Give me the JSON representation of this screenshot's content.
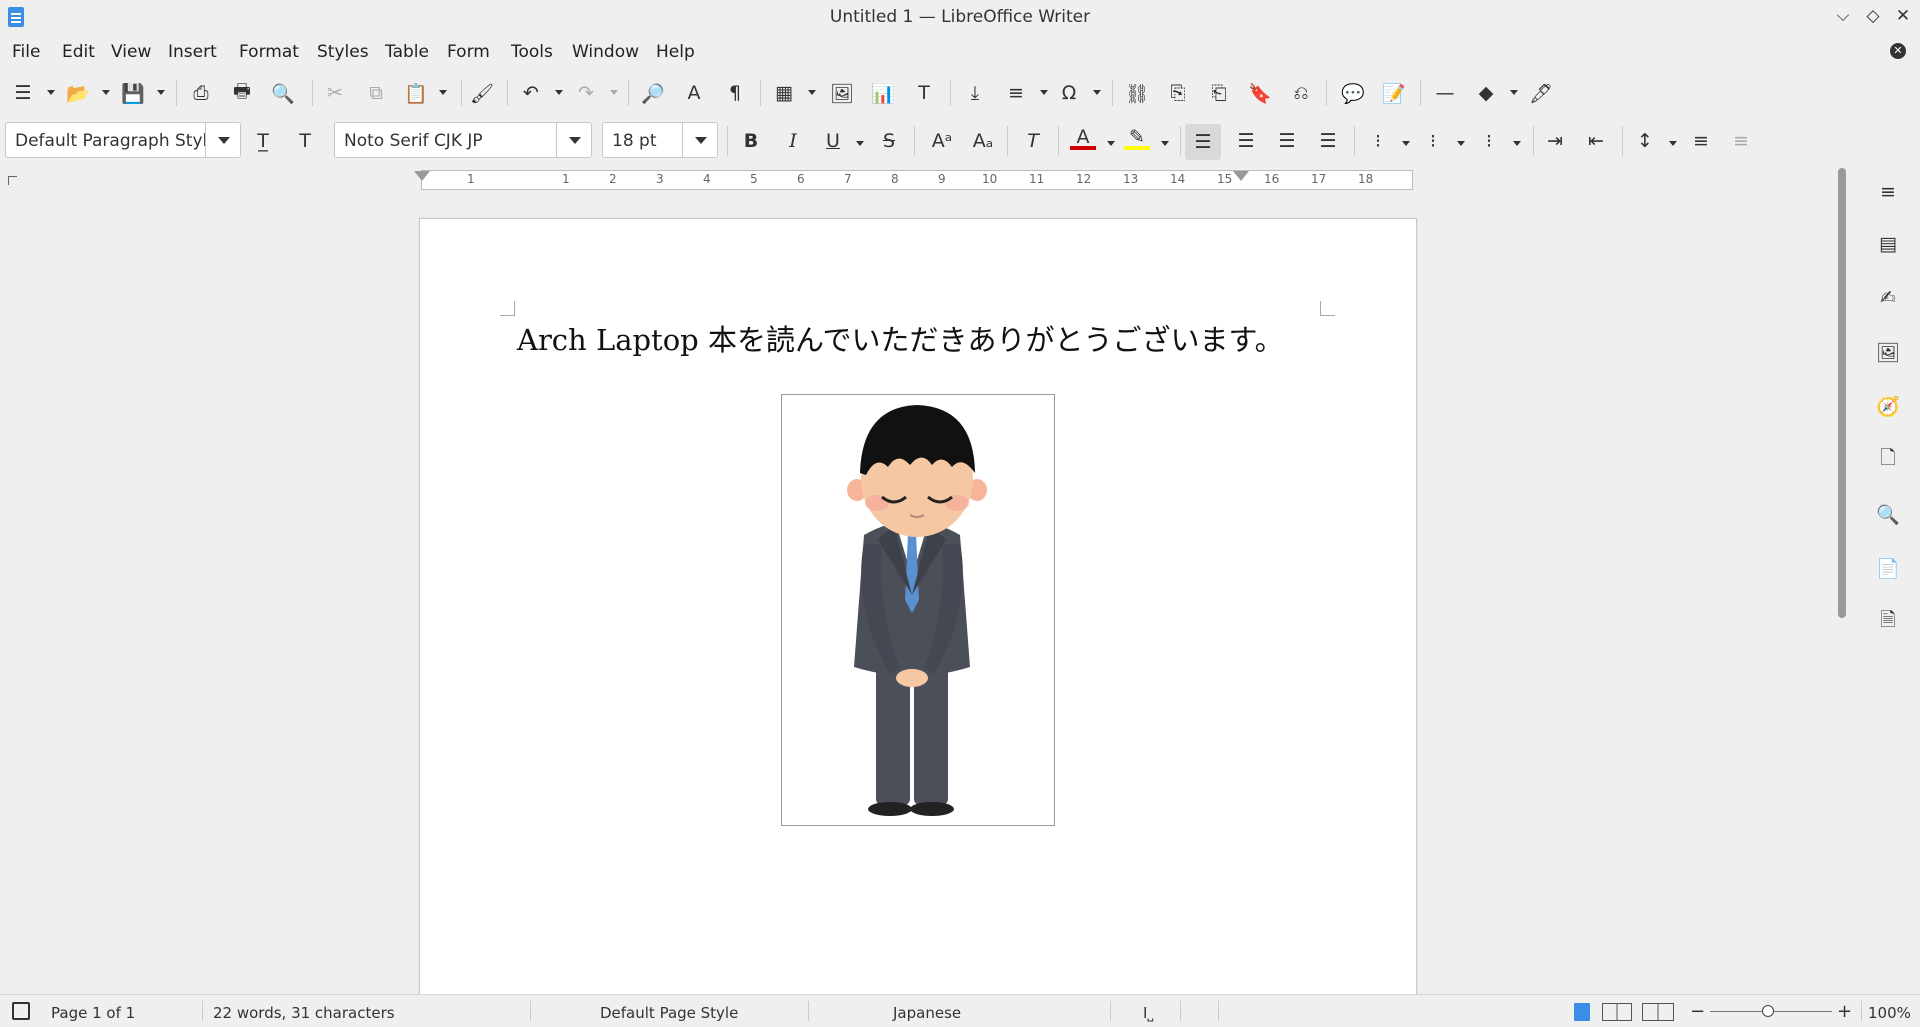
{
  "window": {
    "title": "Untitled 1 — LibreOffice Writer",
    "controls": [
      "⌵",
      "◇",
      "✕"
    ]
  },
  "menu": [
    "File",
    "Edit",
    "View",
    "Insert",
    "Format",
    "Styles",
    "Table",
    "Form",
    "Tools",
    "Window",
    "Help"
  ],
  "formatting": {
    "paragraph_style": "Default Paragraph Style",
    "font_name": "Noto Serif CJK JP",
    "font_size": "18 pt",
    "font_color": "#cc0000",
    "highlight_color": "#ffff00"
  },
  "ruler": {
    "ticks": [
      "1",
      "1",
      "2",
      "3",
      "4",
      "5",
      "6",
      "7",
      "8",
      "9",
      "10",
      "11",
      "12",
      "13",
      "14",
      "15",
      "16",
      "17",
      "18"
    ]
  },
  "document": {
    "text": "Arch Laptop 本を読んでいただきありがとうございます。",
    "image": "bowing-businessman-illustration"
  },
  "status": {
    "page": "Page 1 of 1",
    "words": "22 words, 31 characters",
    "page_style": "Default Page Style",
    "language": "Japanese",
    "zoom": "100%",
    "zoom_minus": "−",
    "zoom_plus": "+"
  }
}
